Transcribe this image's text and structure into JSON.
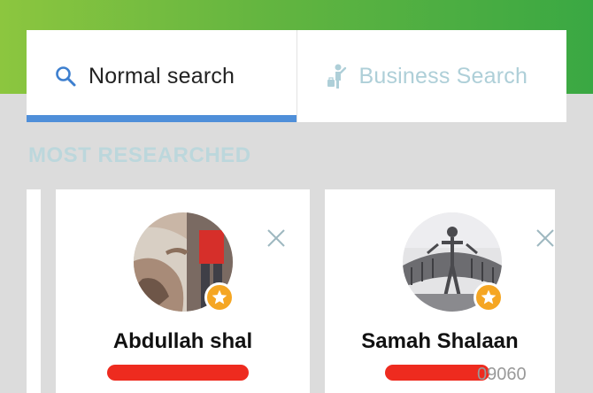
{
  "tabs": [
    {
      "label": "Normal search",
      "icon": "search-icon",
      "active": true
    },
    {
      "label": "Business Search",
      "icon": "business-person-icon",
      "active": false
    }
  ],
  "section": {
    "title": "MOST RESEARCHED"
  },
  "cards": [
    {
      "name": "Abdullah shal",
      "phone_redacted": true,
      "photo": "person-on-rocks-photo",
      "badge": "star-badge"
    },
    {
      "name": "Samah Shalaan",
      "phone_visible_fragment": "09060",
      "phone_redacted": true,
      "photo": "metal-figure-photo",
      "badge": "star-badge"
    }
  ],
  "colors": {
    "header_gradient_start": "#8cc63f",
    "header_gradient_end": "#3aa843",
    "tab_indicator": "#4f8fd9",
    "section_title": "#bcd7dc",
    "star_badge": "#f5a623",
    "redaction": "#ee2b1f"
  }
}
